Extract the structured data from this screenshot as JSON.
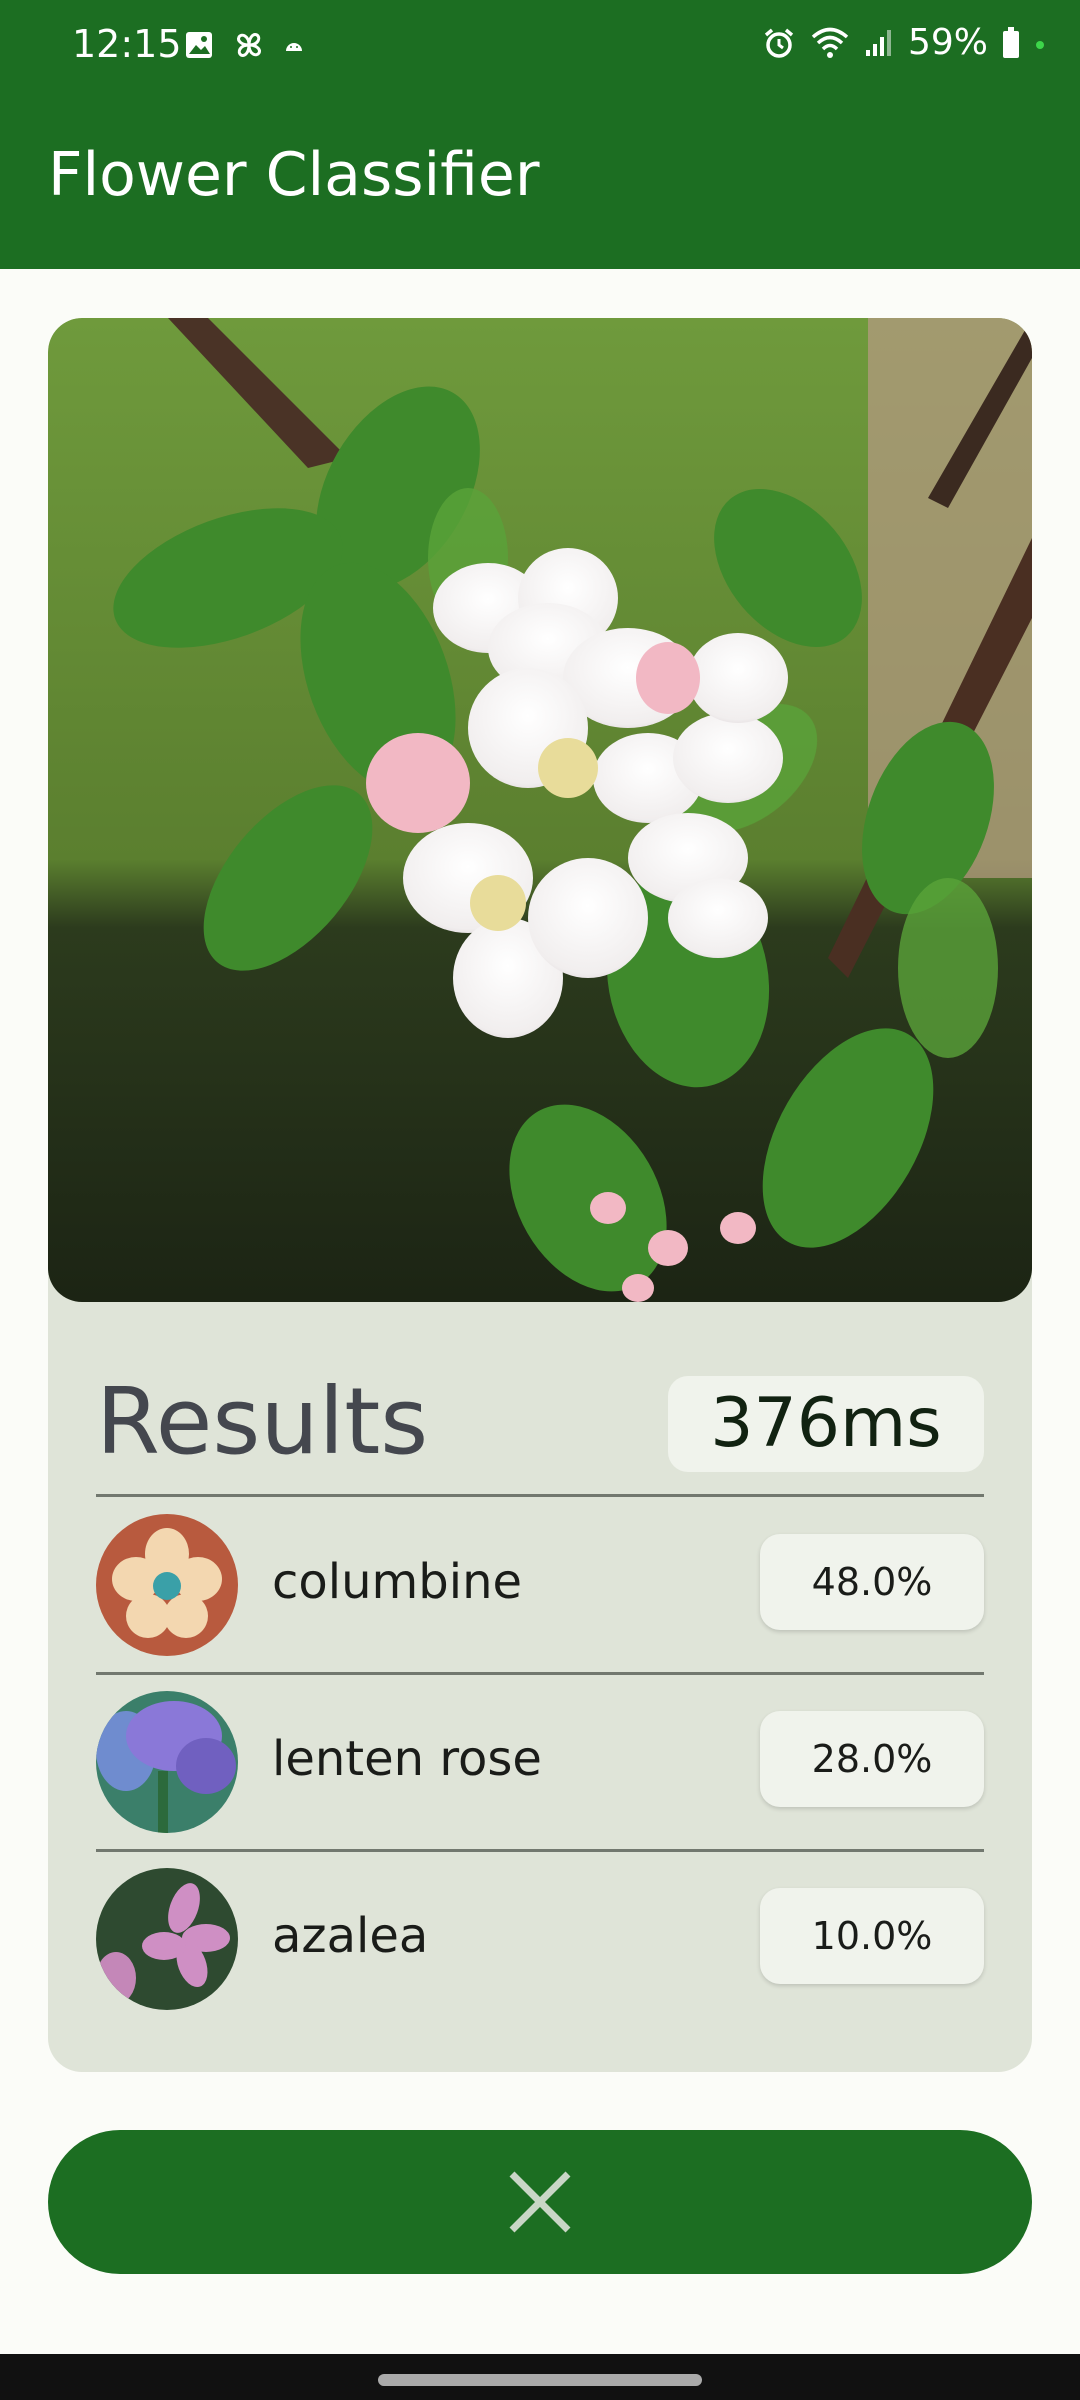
{
  "status_bar": {
    "time": "12:15",
    "battery": "59%",
    "icons": [
      "gallery-icon",
      "pinwheel-icon",
      "android-icon",
      "alarm-icon",
      "wifi-icon",
      "signal-icon",
      "battery-icon"
    ]
  },
  "app_bar": {
    "title": "Flower Classifier"
  },
  "results": {
    "title": "Results",
    "inference_time": "376ms",
    "items": [
      {
        "label": "columbine",
        "confidence": "48.0%"
      },
      {
        "label": "lenten rose",
        "confidence": "28.0%"
      },
      {
        "label": "azalea",
        "confidence": "10.0%"
      }
    ]
  },
  "actions": {
    "close_icon": "close-icon"
  },
  "colors": {
    "primary": "#1c6e22",
    "card": "#dfe4d8",
    "chip": "#f0f3ec",
    "background": "#fbfcf8"
  }
}
